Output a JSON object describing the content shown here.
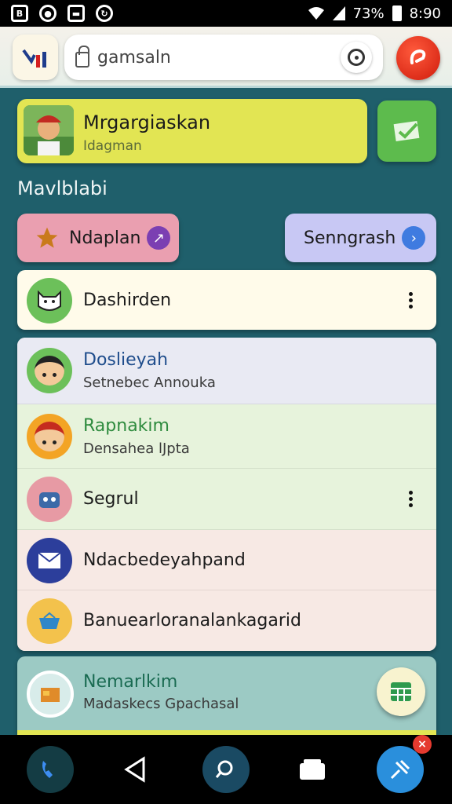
{
  "status_bar": {
    "battery": "73%",
    "time": "8:90"
  },
  "search": {
    "value": "gamsaln",
    "placeholder": "gamsaln"
  },
  "profile": {
    "name": "Mrgargiaskan",
    "subtitle": "Idagman"
  },
  "section_label": "Mavlblabi",
  "chips": [
    {
      "label": "Ndaplan",
      "dot": "↗"
    },
    {
      "label": "Senngrash",
      "dot": "›"
    }
  ],
  "list_top": {
    "title": "Dashirden"
  },
  "list": [
    {
      "title": "Doslieyah",
      "subtitle": "Setnebec Annouka",
      "title_color": "#1f4d8c",
      "bg": "#e9eaf3"
    },
    {
      "title": "Rapnakim",
      "subtitle": "Densahea lJpta",
      "title_color": "#2e8b3e",
      "bg": "#e7f3dc"
    },
    {
      "title": "Segrul",
      "subtitle": "",
      "title_color": "#1b1b1b",
      "bg": "#e7f3dc"
    },
    {
      "title": "Ndacbedeyahpand",
      "subtitle": "",
      "title_color": "#1b1b1b",
      "bg": "#f7e9e4"
    },
    {
      "title": "Banuearloranalankagarid",
      "subtitle": "",
      "title_color": "#1b1b1b",
      "bg": "#f7e9e4"
    }
  ],
  "bottom_item": {
    "title": "Nemarlkim",
    "subtitle": "Madaskecs Gpachasal"
  },
  "nav": {
    "badge": "×"
  },
  "icons": [
    "wifi-icon",
    "signal-icon",
    "battery-icon",
    "lock-icon",
    "target-icon",
    "star-icon",
    "check-icon",
    "mail-icon",
    "phone-icon",
    "back-icon",
    "search-icon",
    "files-icon",
    "pin-icon"
  ]
}
